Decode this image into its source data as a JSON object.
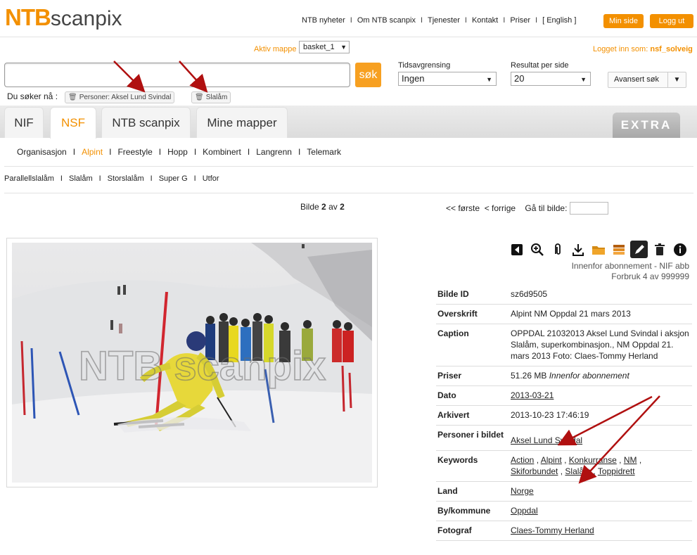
{
  "header": {
    "logo_ntb": "NTB",
    "logo_scanpix": "scanpix",
    "nav": [
      "NTB nyheter",
      "Om NTB scanpix",
      "Tjenester",
      "Kontakt",
      "Priser",
      "[ English ]"
    ],
    "min_side": "Min side",
    "logg_ut": "Logg ut",
    "aktiv_mappe_label": "Aktiv mappe",
    "aktiv_mappe_value": "basket_1",
    "logged_in_label": "Logget inn som:",
    "logged_in_user": "nsf_solveig"
  },
  "search": {
    "value": "",
    "button": "søk",
    "tids_label": "Tidsavgrensing",
    "tids_value": "Ingen",
    "result_label": "Resultat per side",
    "result_value": "20",
    "advanced": "Avansert søk",
    "du_soker": "Du søker nå :",
    "chips": [
      "Personer: Aksel Lund Svindal",
      "Slalåm"
    ]
  },
  "tabs": [
    "NIF",
    "NSF",
    "NTB scanpix",
    "Mine mapper"
  ],
  "extra_label": "EXTRA",
  "subnav1": [
    "Organisasjon",
    "Alpint",
    "Freestyle",
    "Hopp",
    "Kombinert",
    "Langrenn",
    "Telemark"
  ],
  "subnav2": [
    "Parallellslalåm",
    "Slalåm",
    "Storslalåm",
    "Super G",
    "Utfor"
  ],
  "pager": {
    "bilde_word": "Bilde",
    "bilde_current": "2",
    "av_word": "av",
    "bilde_total": "2",
    "forste": "<< første",
    "forrige": "< forrige",
    "goto_label": "Gå til bilde:"
  },
  "photo": {
    "watermark": "NTB scanpix"
  },
  "abonnement": {
    "line1": "Innenfor abonnement - NIF abb",
    "line2": "Forbruk 4 av 999999"
  },
  "meta": {
    "bilde_id_k": "Bilde ID",
    "bilde_id_v": "sz6d9505",
    "overskrift_k": "Overskrift",
    "overskrift_v": "Alpint NM Oppdal 21 mars 2013",
    "caption_k": "Caption",
    "caption_v": "OPPDAL 21032013 Aksel Lund Svindal i aksjon Slalåm, superkombinasjon., NM Oppdal 21. mars 2013 Foto: Claes-Tommy Herland",
    "priser_k": "Priser",
    "priser_size": "51.26 MB",
    "priser_note": "Innenfor abonnement",
    "dato_k": "Dato",
    "dato_v": "2013-03-21",
    "arkivert_k": "Arkivert",
    "arkivert_v": "2013-10-23 17:46:19",
    "personer_k": "Personer i bildet",
    "personer_v": "Aksel Lund Svindal",
    "keywords_k": "Keywords",
    "keywords": [
      "Action",
      "Alpint",
      "Konkurranse",
      "NM",
      "Skiforbundet",
      "Slalåm",
      "Toppidrett"
    ],
    "land_k": "Land",
    "land_v": "Norge",
    "by_k": "By/kommune",
    "by_v": "Oppdal",
    "foto_k": "Fotograf",
    "foto_v": "Claes-Tommy Herland"
  },
  "colors": {
    "accent": "#f39000",
    "annotation_arrow": "#b01010"
  }
}
